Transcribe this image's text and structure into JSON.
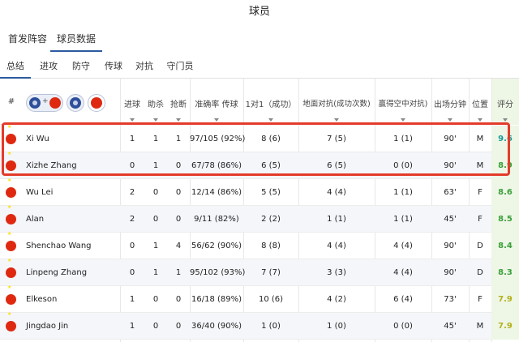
{
  "title": "球员",
  "tabs_top": [
    {
      "label": "首发阵容",
      "active": false
    },
    {
      "label": "球员数据",
      "active": true
    }
  ],
  "tabs_sub": [
    {
      "label": "总结",
      "active": true
    },
    {
      "label": "进攻",
      "active": false
    },
    {
      "label": "防守",
      "active": false
    },
    {
      "label": "传球",
      "active": false
    },
    {
      "label": "对抗",
      "active": false
    },
    {
      "label": "守门员",
      "active": false
    }
  ],
  "table": {
    "header_index": "#",
    "filter": {
      "plus": "+"
    },
    "columns": [
      "进球",
      "助杀",
      "抢断",
      "准确率 传球",
      "1对1（成功）",
      "地面对抗(成功次数)",
      "赢得空中对抗)",
      "出场分钟",
      "位置",
      "评分"
    ],
    "rows": [
      {
        "name": "Xi Wu",
        "goals": "1",
        "assists": "1",
        "tackles": "1",
        "passing": "97/105 (92%)",
        "duels_1v1": "8 (6)",
        "ground_duels": "7 (5)",
        "aerial_won": "1 (1)",
        "minutes": "90'",
        "position": "M",
        "rating": "9.6",
        "rating_color": "#1a9a9a"
      },
      {
        "name": "Xizhe Zhang",
        "goals": "0",
        "assists": "1",
        "tackles": "0",
        "passing": "67/78 (86%)",
        "duels_1v1": "6 (5)",
        "ground_duels": "6 (5)",
        "aerial_won": "0 (0)",
        "minutes": "90'",
        "position": "M",
        "rating": "8.9",
        "rating_color": "#3aa03a"
      },
      {
        "name": "Wu Lei",
        "goals": "2",
        "assists": "0",
        "tackles": "0",
        "passing": "12/14 (86%)",
        "duels_1v1": "5 (5)",
        "ground_duels": "4 (4)",
        "aerial_won": "1 (1)",
        "minutes": "63'",
        "position": "F",
        "rating": "8.6",
        "rating_color": "#3aa03a"
      },
      {
        "name": "Alan",
        "goals": "2",
        "assists": "0",
        "tackles": "0",
        "passing": "9/11 (82%)",
        "duels_1v1": "2 (2)",
        "ground_duels": "1 (1)",
        "aerial_won": "1 (1)",
        "minutes": "45'",
        "position": "F",
        "rating": "8.5",
        "rating_color": "#3aa03a"
      },
      {
        "name": "Shenchao Wang",
        "goals": "0",
        "assists": "1",
        "tackles": "4",
        "passing": "56/62 (90%)",
        "duels_1v1": "8 (8)",
        "ground_duels": "4 (4)",
        "aerial_won": "4 (4)",
        "minutes": "90'",
        "position": "D",
        "rating": "8.4",
        "rating_color": "#3aa03a"
      },
      {
        "name": "Linpeng Zhang",
        "goals": "0",
        "assists": "1",
        "tackles": "1",
        "passing": "95/102 (93%)",
        "duels_1v1": "7 (7)",
        "ground_duels": "3 (3)",
        "aerial_won": "4 (4)",
        "minutes": "90'",
        "position": "D",
        "rating": "8.3",
        "rating_color": "#3aa03a"
      },
      {
        "name": "Elkeson",
        "goals": "1",
        "assists": "0",
        "tackles": "0",
        "passing": "16/18 (89%)",
        "duels_1v1": "10 (6)",
        "ground_duels": "4 (2)",
        "aerial_won": "6 (4)",
        "minutes": "73'",
        "position": "F",
        "rating": "7.9",
        "rating_color": "#b5b01a"
      },
      {
        "name": "Jingdao Jin",
        "goals": "1",
        "assists": "0",
        "tackles": "0",
        "passing": "36/40 (90%)",
        "duels_1v1": "1 (0)",
        "ground_duels": "1 (0)",
        "aerial_won": "0 (0)",
        "minutes": "45'",
        "position": "M",
        "rating": "7.9",
        "rating_color": "#b5b01a"
      }
    ]
  },
  "colors": {
    "accent": "#2c5aa0",
    "highlight_border": "#e43b2a",
    "flag_red": "#de2910"
  },
  "icons": {
    "filter_team_badge": "team-crest-icon",
    "flag": "china-flag-icon"
  }
}
